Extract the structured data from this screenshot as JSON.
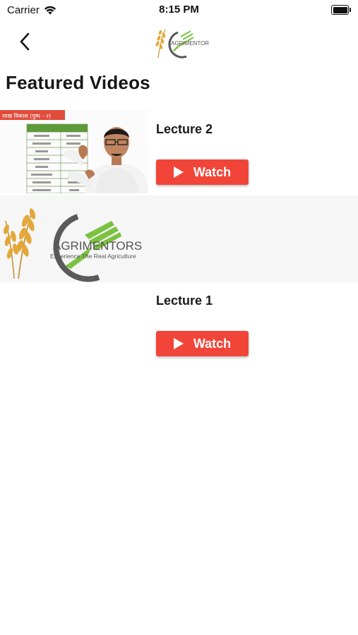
{
  "status_bar": {
    "carrier": "Carrier",
    "time": "8:15 PM"
  },
  "nav": {
    "back_icon": "chevron-left-icon",
    "logo_text": "AGRIMENTORS",
    "logo_tagline": "Experience The Real Agriculture"
  },
  "page": {
    "title": "Featured Videos"
  },
  "videos": [
    {
      "title": "Lecture 2",
      "watch_label": "Watch",
      "thumb_heading": "लाख विकास (पुष्प - २)"
    },
    {
      "title": "Lecture 1",
      "watch_label": "Watch",
      "logo_text": "AGRIMENTORS",
      "logo_tagline": "Experience The Real Agriculture"
    }
  ],
  "colors": {
    "accent": "#f1453a",
    "alt_row_bg": "#f6f6f6",
    "logo_green": "#7cc242",
    "logo_gray": "#555555",
    "wheat": "#e3a83a"
  }
}
